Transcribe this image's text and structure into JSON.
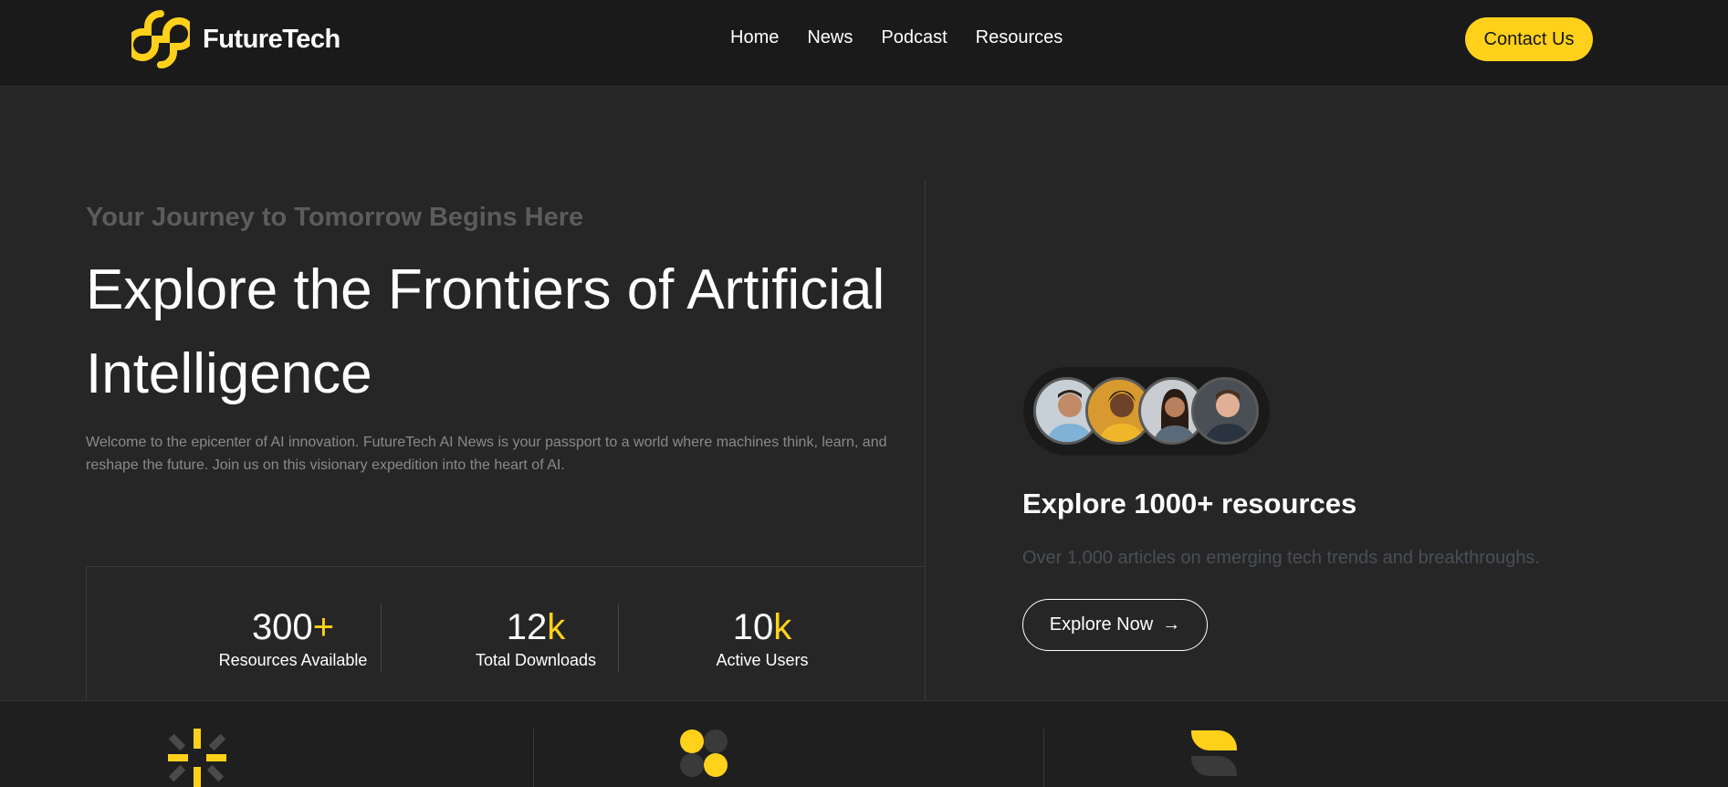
{
  "header": {
    "logo_text": "FutureTech",
    "nav": [
      "Home",
      "News",
      "Podcast",
      "Resources"
    ],
    "contact_label": "Contact Us"
  },
  "hero": {
    "tagline": "Your Journey to Tomorrow Begins Here",
    "headline": "Explore the Frontiers of Artificial Intelligence",
    "intro": "Welcome to the epicenter of AI innovation. FutureTech AI News is your passport to a world where machines think, learn, and reshape the future. Join us on this visionary expedition into the heart of AI."
  },
  "stats": [
    {
      "value": "300",
      "suffix": "+",
      "label": "Resources Available"
    },
    {
      "value": "12",
      "suffix": "k",
      "label": "Total Downloads"
    },
    {
      "value": "10",
      "suffix": "k",
      "label": "Active Users"
    }
  ],
  "resources": {
    "title": "Explore 1000+ resources",
    "subtitle": "Over 1,000 articles on emerging tech trends and breakthroughs.",
    "button_label": "Explore Now",
    "button_icon": "arrow-right-icon"
  },
  "colors": {
    "accent": "#ffd11a",
    "background": "#262626",
    "header_bg": "#1a1a1a"
  },
  "features": {
    "icons": [
      "sparkle-icon",
      "blob-cluster-icon",
      "leaf-icon"
    ]
  }
}
